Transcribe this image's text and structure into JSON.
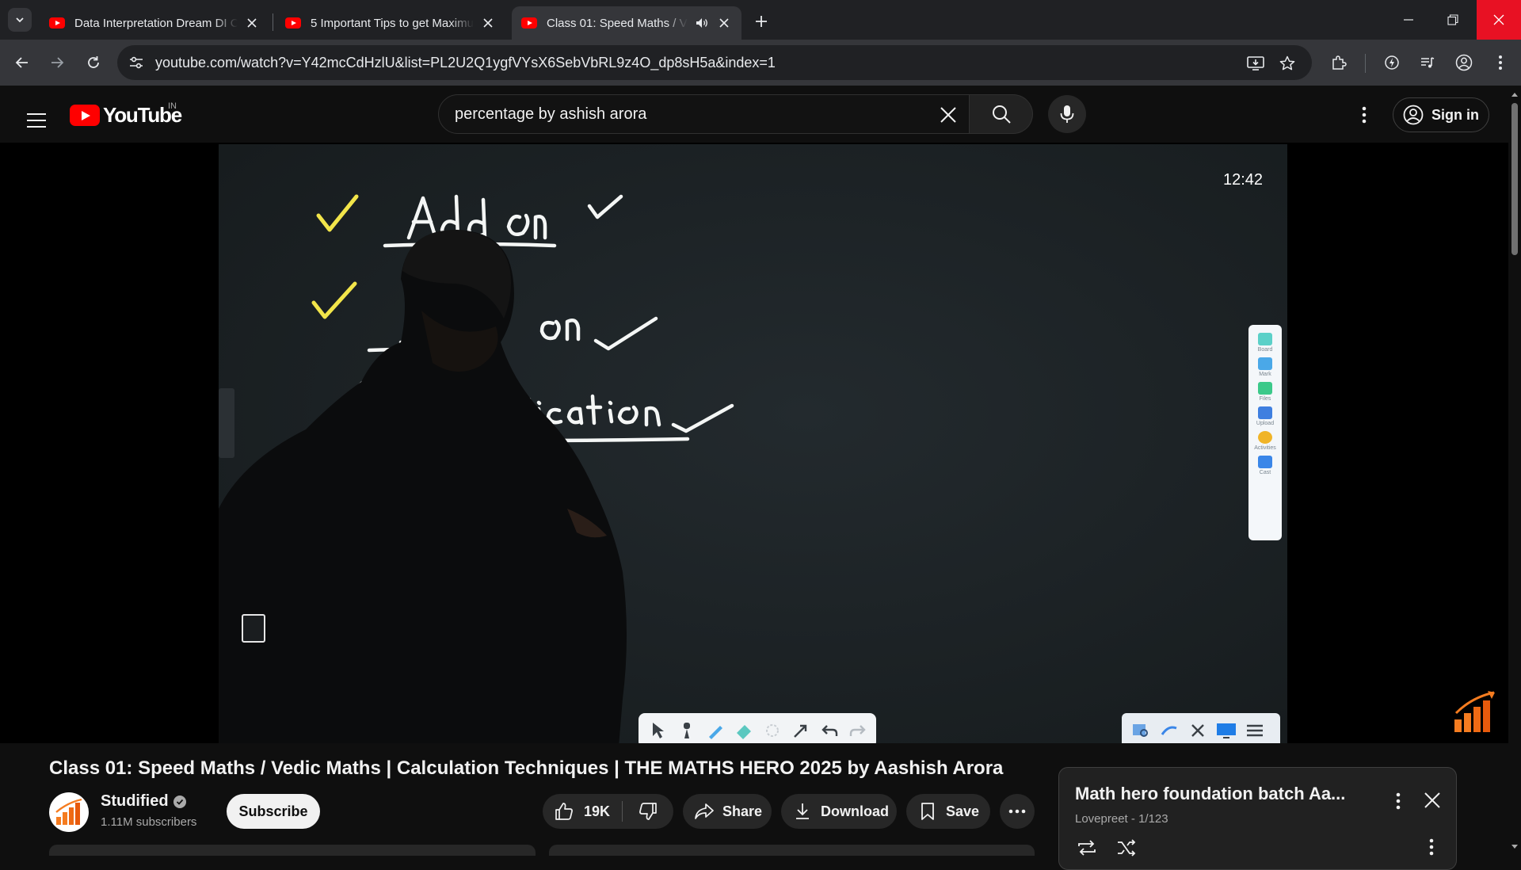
{
  "browser": {
    "tabs": [
      {
        "title": "Data Interpretation Dream DI Cl",
        "active": false
      },
      {
        "title": "5 Important Tips to get Maximu",
        "active": false
      },
      {
        "title": "Class 01: Speed Maths / Vedic",
        "active": true,
        "audio": true
      }
    ],
    "url": "youtube.com/watch?v=Y42mcCdHzlU&list=PL2U2Q1ygfVYsX6SebVbRL9z4O_dp8sH5a&index=1"
  },
  "youtube": {
    "logo_text": "YouTube",
    "country_code": "IN",
    "search_query": "percentage by ashish arora",
    "sign_in": "Sign in"
  },
  "player": {
    "overlay_time": "12:42",
    "board_side_labels": [
      "Board",
      "Mark",
      "Files",
      "Upload",
      "Activities",
      "Cast"
    ],
    "board_colors": {
      "board": "#1e2427",
      "chalk": "#f4f6f5",
      "check_yellow": "#f2e54a"
    }
  },
  "video": {
    "title": "Class 01: Speed Maths / Vedic Maths | Calculation Techniques | THE MATHS HERO 2025 by Aashish Arora",
    "channel": "Studified",
    "subscribers": "1.11M subscribers",
    "subscribe_label": "Subscribe",
    "likes": "19K",
    "share_label": "Share",
    "download_label": "Download",
    "save_label": "Save"
  },
  "playlist": {
    "title": "Math hero foundation batch Aa...",
    "owner": "Lovepreet",
    "position": "1/123"
  }
}
